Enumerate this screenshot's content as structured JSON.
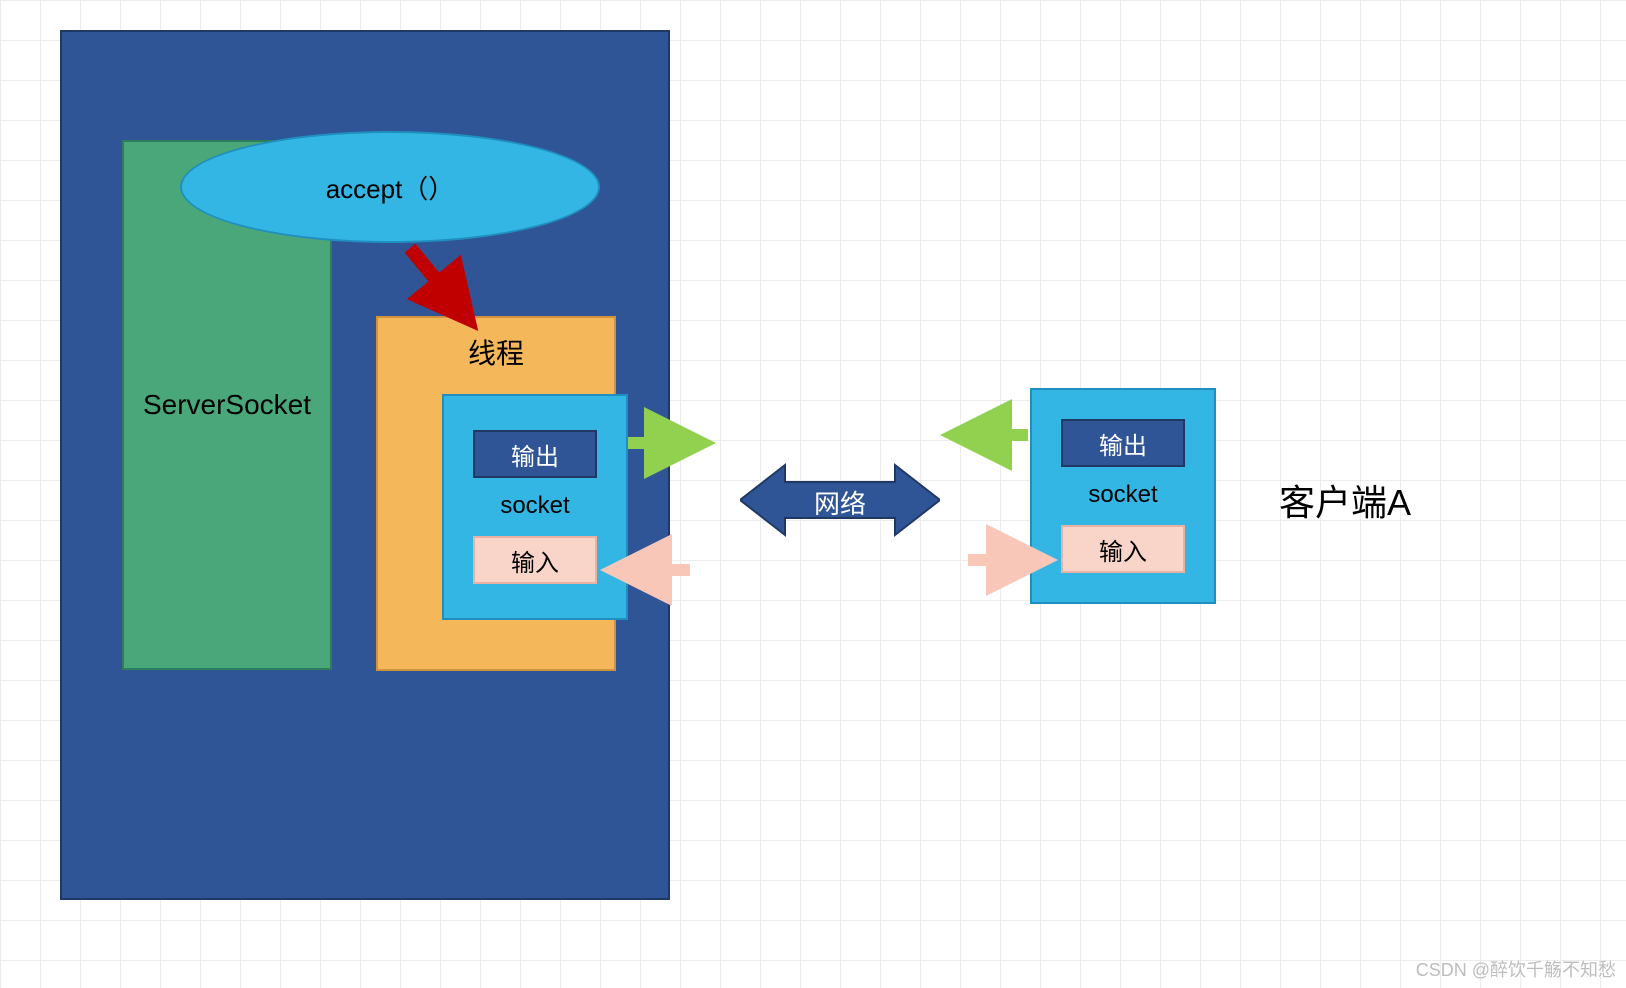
{
  "server": {
    "server_socket_label": "ServerSocket",
    "accept_label": "accept（）",
    "thread_label": "线程",
    "socket_label": "socket",
    "output_label": "输出",
    "input_label": "输入"
  },
  "client": {
    "label": "客户端A",
    "socket_label": "socket",
    "output_label": "输出",
    "input_label": "输入"
  },
  "network": {
    "label": "网络"
  },
  "colors": {
    "server_container": "#2f5597",
    "server_socket": "#4aa77a",
    "accept_ellipse": "#34b6e4",
    "thread_box": "#f4b85b",
    "socket_box": "#34b6e4",
    "output_chip": "#2f5597",
    "input_chip": "#f9d4c9",
    "arrow_red": "#c00000",
    "arrow_green": "#92d050",
    "arrow_pink": "#f8c7b8",
    "arrow_network": "#2f5597"
  },
  "watermark": "CSDN @醉饮千觞不知愁"
}
